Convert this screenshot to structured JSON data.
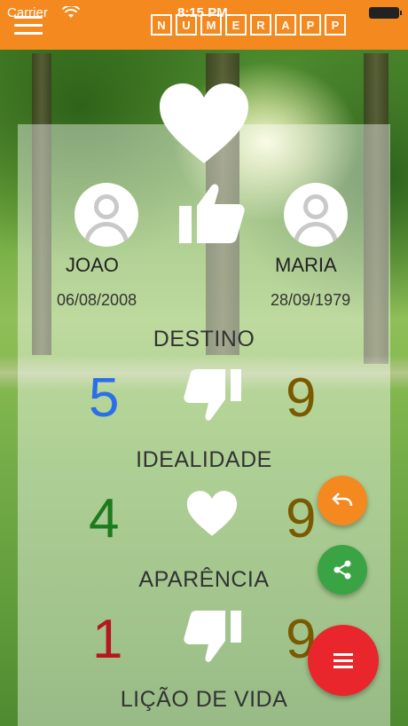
{
  "status_bar": {
    "carrier": "Carrier",
    "time": "8:15 PM"
  },
  "app_bar": {
    "logo_letters": [
      "N",
      "U",
      "M",
      "E",
      "R",
      "A",
      "P",
      "P"
    ]
  },
  "person1": {
    "name": "JOAO",
    "birthdate": "06/08/2008"
  },
  "person2": {
    "name": "MARIA",
    "birthdate": "28/09/1979"
  },
  "sections": [
    {
      "title": "DESTINO",
      "value1": "5",
      "value2": "9",
      "value1_color": "#2b6fe8",
      "value2_color": "#7a5a00",
      "verdict_icon": "thumbs-down-icon"
    },
    {
      "title": "IDEALIDADE",
      "value1": "4",
      "value2": "9",
      "value1_color": "#1d7a1d",
      "value2_color": "#7a5a00",
      "verdict_icon": "heart-icon"
    },
    {
      "title": "APARÊNCIA",
      "value1": "1",
      "value2": "9",
      "value1_color": "#b5171e",
      "value2_color": "#7a5a00",
      "verdict_icon": "thumbs-down-icon"
    },
    {
      "title": "LIÇÃO DE VIDA"
    }
  ],
  "colors": {
    "app_bar": "#f4891f",
    "fab_undo": "#f4891f",
    "fab_share": "#3aa445",
    "fab_menu": "#e8262c"
  },
  "fabs": [
    {
      "icon": "undo-icon"
    },
    {
      "icon": "share-icon"
    },
    {
      "icon": "menu-icon"
    }
  ]
}
